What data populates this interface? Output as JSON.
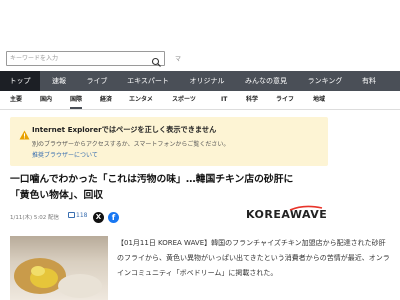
{
  "search": {
    "placeholder": "キーワードを入力"
  },
  "header_mark": "マ",
  "nav_primary": [
    {
      "label": "トップ",
      "active": true
    },
    {
      "label": "速報"
    },
    {
      "label": "ライブ"
    },
    {
      "label": "エキスパート"
    },
    {
      "label": "オリジナル"
    },
    {
      "label": "みんなの意見"
    },
    {
      "label": "ランキング"
    },
    {
      "label": "有料"
    }
  ],
  "nav_secondary": [
    {
      "label": "主要"
    },
    {
      "label": "国内"
    },
    {
      "label": "国際",
      "active": true
    },
    {
      "label": "経済"
    },
    {
      "label": "エンタメ"
    },
    {
      "label": "スポーツ"
    },
    {
      "label": "IT"
    },
    {
      "label": "科学"
    },
    {
      "label": "ライフ"
    },
    {
      "label": "地域"
    }
  ],
  "ie_notice": {
    "title": "Internet Explorerではページを正しく表示できません",
    "message": "別のブラウザーからアクセスするか、スマートフォンからご覧ください。",
    "link": "推奨ブラウザーについて"
  },
  "article": {
    "headline": "一口噛んでわかった「これは汚物の味」…韓国チキン店の砂肝に「黄色い物体」、回収",
    "date": "1/11(木) 5:02 配信",
    "comment_count": "118",
    "source_logo": "KOREAWAVE",
    "body": "【01月11日 KOREA WAVE】韓国のフランチャイズチキン加盟店から配達された砂肝のフライから、黄色い異物がいっぱい出てきたという消費者からの苦情が最近、オンラインコミュニティ「ボベドリーム」に掲載された。"
  },
  "colors": {
    "nav_bg": "#4a4f57",
    "nav_active": "#1c1f25",
    "notice_bg": "#fdf4d4",
    "link": "#3a6fb0"
  }
}
